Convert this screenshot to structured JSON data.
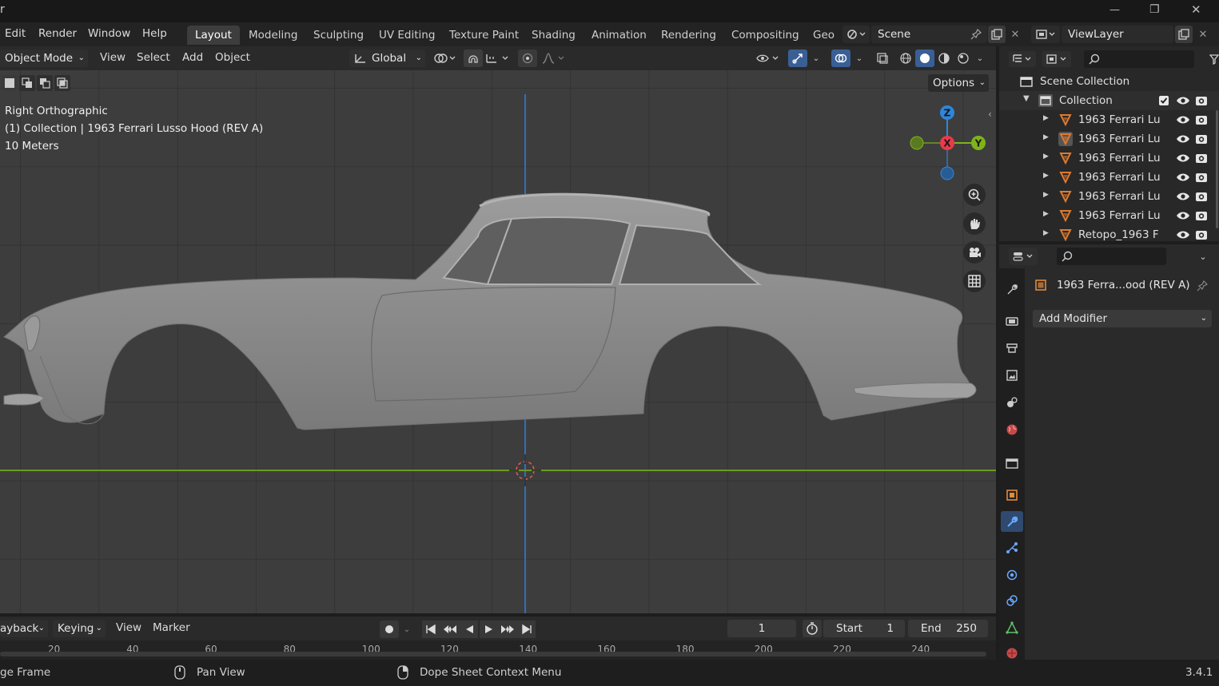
{
  "titlebar": {
    "app_char": "r",
    "minimize": "—",
    "restore": "❐",
    "close": "✕"
  },
  "menu": [
    "Edit",
    "Render",
    "Window",
    "Help"
  ],
  "workspaces": [
    "Layout",
    "Modeling",
    "Sculpting",
    "UV Editing",
    "Texture Paint",
    "Shading",
    "Animation",
    "Rendering",
    "Compositing",
    "Geo"
  ],
  "scene": {
    "label": "Scene"
  },
  "viewlayer": {
    "label": "ViewLayer"
  },
  "viewport_header": {
    "mode": "Object Mode",
    "menus": [
      "View",
      "Select",
      "Add",
      "Object"
    ],
    "transform": "Global"
  },
  "viewport": {
    "options_label": "Options",
    "view_name": "Right Orthographic",
    "object_info": "(1) Collection | 1963 Ferrari Lusso Hood (REV A)",
    "scale": "10 Meters",
    "gizmo": {
      "z": "Z",
      "x": "X",
      "y": "Y"
    }
  },
  "outliner": {
    "root": "Scene Collection",
    "collection": "Collection",
    "items": [
      "1963 Ferrari Lu",
      "1963 Ferrari Lu",
      "1963 Ferrari Lu",
      "1963 Ferrari Lu",
      "1963 Ferrari Lu",
      "1963 Ferrari Lu",
      "Retopo_1963 F"
    ]
  },
  "properties": {
    "object_name": "1963 Ferra...ood (REV A)",
    "add_modifier": "Add Modifier"
  },
  "timeline": {
    "playback": "ayback",
    "keying": "Keying",
    "view": "View",
    "marker": "Marker",
    "current_frame": "1",
    "start_label": "Start",
    "start": "1",
    "end_label": "End",
    "end": "250",
    "ruler": [
      "20",
      "40",
      "60",
      "80",
      "100",
      "120",
      "140",
      "160",
      "180",
      "200",
      "220",
      "240"
    ]
  },
  "status": {
    "left": "ge Frame",
    "pan": "Pan View",
    "context": "Dope Sheet Context Menu",
    "version": "3.4.1"
  },
  "colors": {
    "accent_orange": "#e07a2e",
    "axis_x": "#e83b4a",
    "axis_y": "#7fb31a",
    "axis_z": "#2f86d9"
  }
}
